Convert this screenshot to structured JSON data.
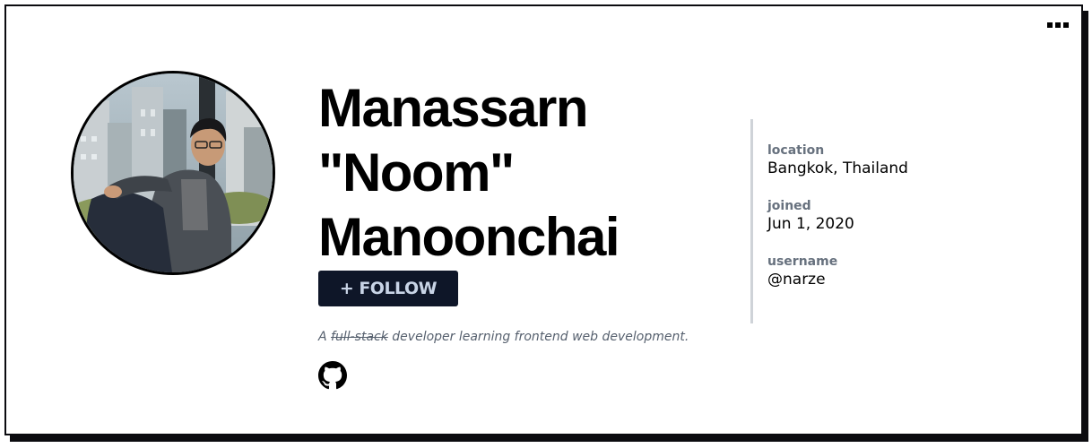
{
  "profile": {
    "name": "Manassarn \"Noom\" Manoonchai",
    "follow_plus": "+",
    "follow_label": "FOLLOW",
    "bio": {
      "prefix": "A ",
      "struck": "full-stack",
      "suffix": " developer learning frontend web development."
    },
    "links": [
      {
        "icon": "github-icon"
      }
    ],
    "avatar": {
      "alt": "Profile photo"
    }
  },
  "details": [
    {
      "label": "location",
      "value": "Bangkok, Thailand"
    },
    {
      "label": "joined",
      "value": "Jun 1, 2020"
    },
    {
      "label": "username",
      "value": "@narze"
    }
  ],
  "menu": {
    "icon": "more-options-icon"
  },
  "colors": {
    "button_bg": "#0e1628",
    "button_text": "#c8d4e6",
    "label_text": "#67717e",
    "bio_text": "#56606e",
    "divider": "#cfd3d8",
    "card_border": "#0b0b0f"
  }
}
